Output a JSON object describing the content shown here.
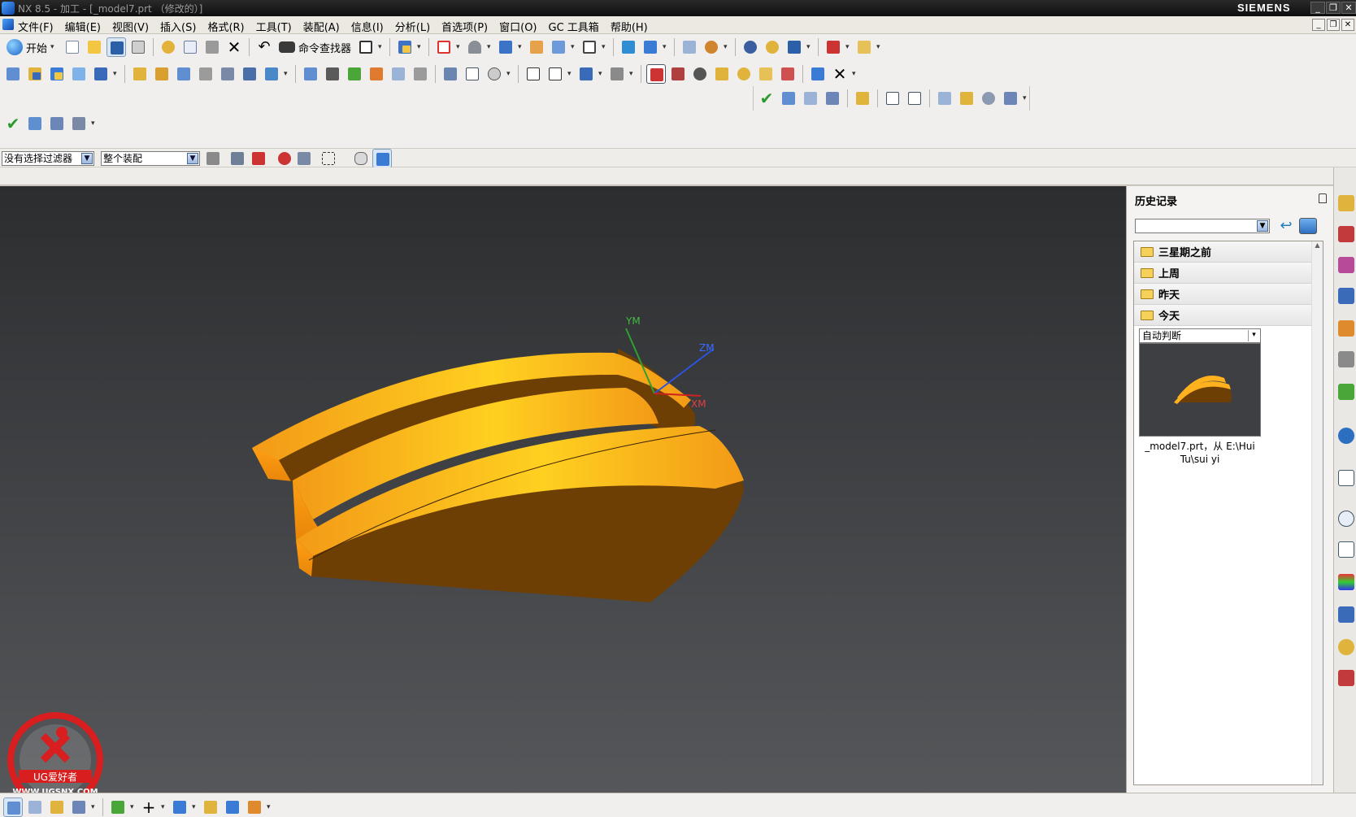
{
  "window": {
    "title": "NX 8.5 - 加工 - [_model7.prt （修改的）]",
    "brand": "SIEMENS",
    "controls": [
      "_",
      "❐",
      "✕"
    ]
  },
  "menu": {
    "items": [
      "文件(F)",
      "编辑(E)",
      "视图(V)",
      "插入(S)",
      "格式(R)",
      "工具(T)",
      "装配(A)",
      "信息(I)",
      "分析(L)",
      "首选项(P)",
      "窗口(O)",
      "GC 工具箱",
      "帮助(H)"
    ],
    "doc_controls": [
      "_",
      "❐",
      "✕"
    ]
  },
  "toolbar": {
    "start_label": "开始",
    "command_finder_label": "命令查找器"
  },
  "selection_bar": {
    "filter_value": "没有选择过滤器",
    "scope_value": "整个装配"
  },
  "viewport": {
    "axes": {
      "y": "YM",
      "z": "ZM",
      "x": "XM"
    },
    "colors": {
      "part_light": "#ffa21c",
      "part_dark": "#6e3f05",
      "background": "#3e4043"
    }
  },
  "history": {
    "title": "历史记录",
    "groups": [
      "三星期之前",
      "上周",
      "昨天",
      "今天"
    ],
    "view_mode": "自动判断",
    "item_caption_line1": "_model7.prt，从 E:\\Hui",
    "item_caption_line2": "Tu\\sui yi"
  },
  "watermark": {
    "text": "UG爱好者",
    "url": "WWW.UGSNX.COM"
  }
}
